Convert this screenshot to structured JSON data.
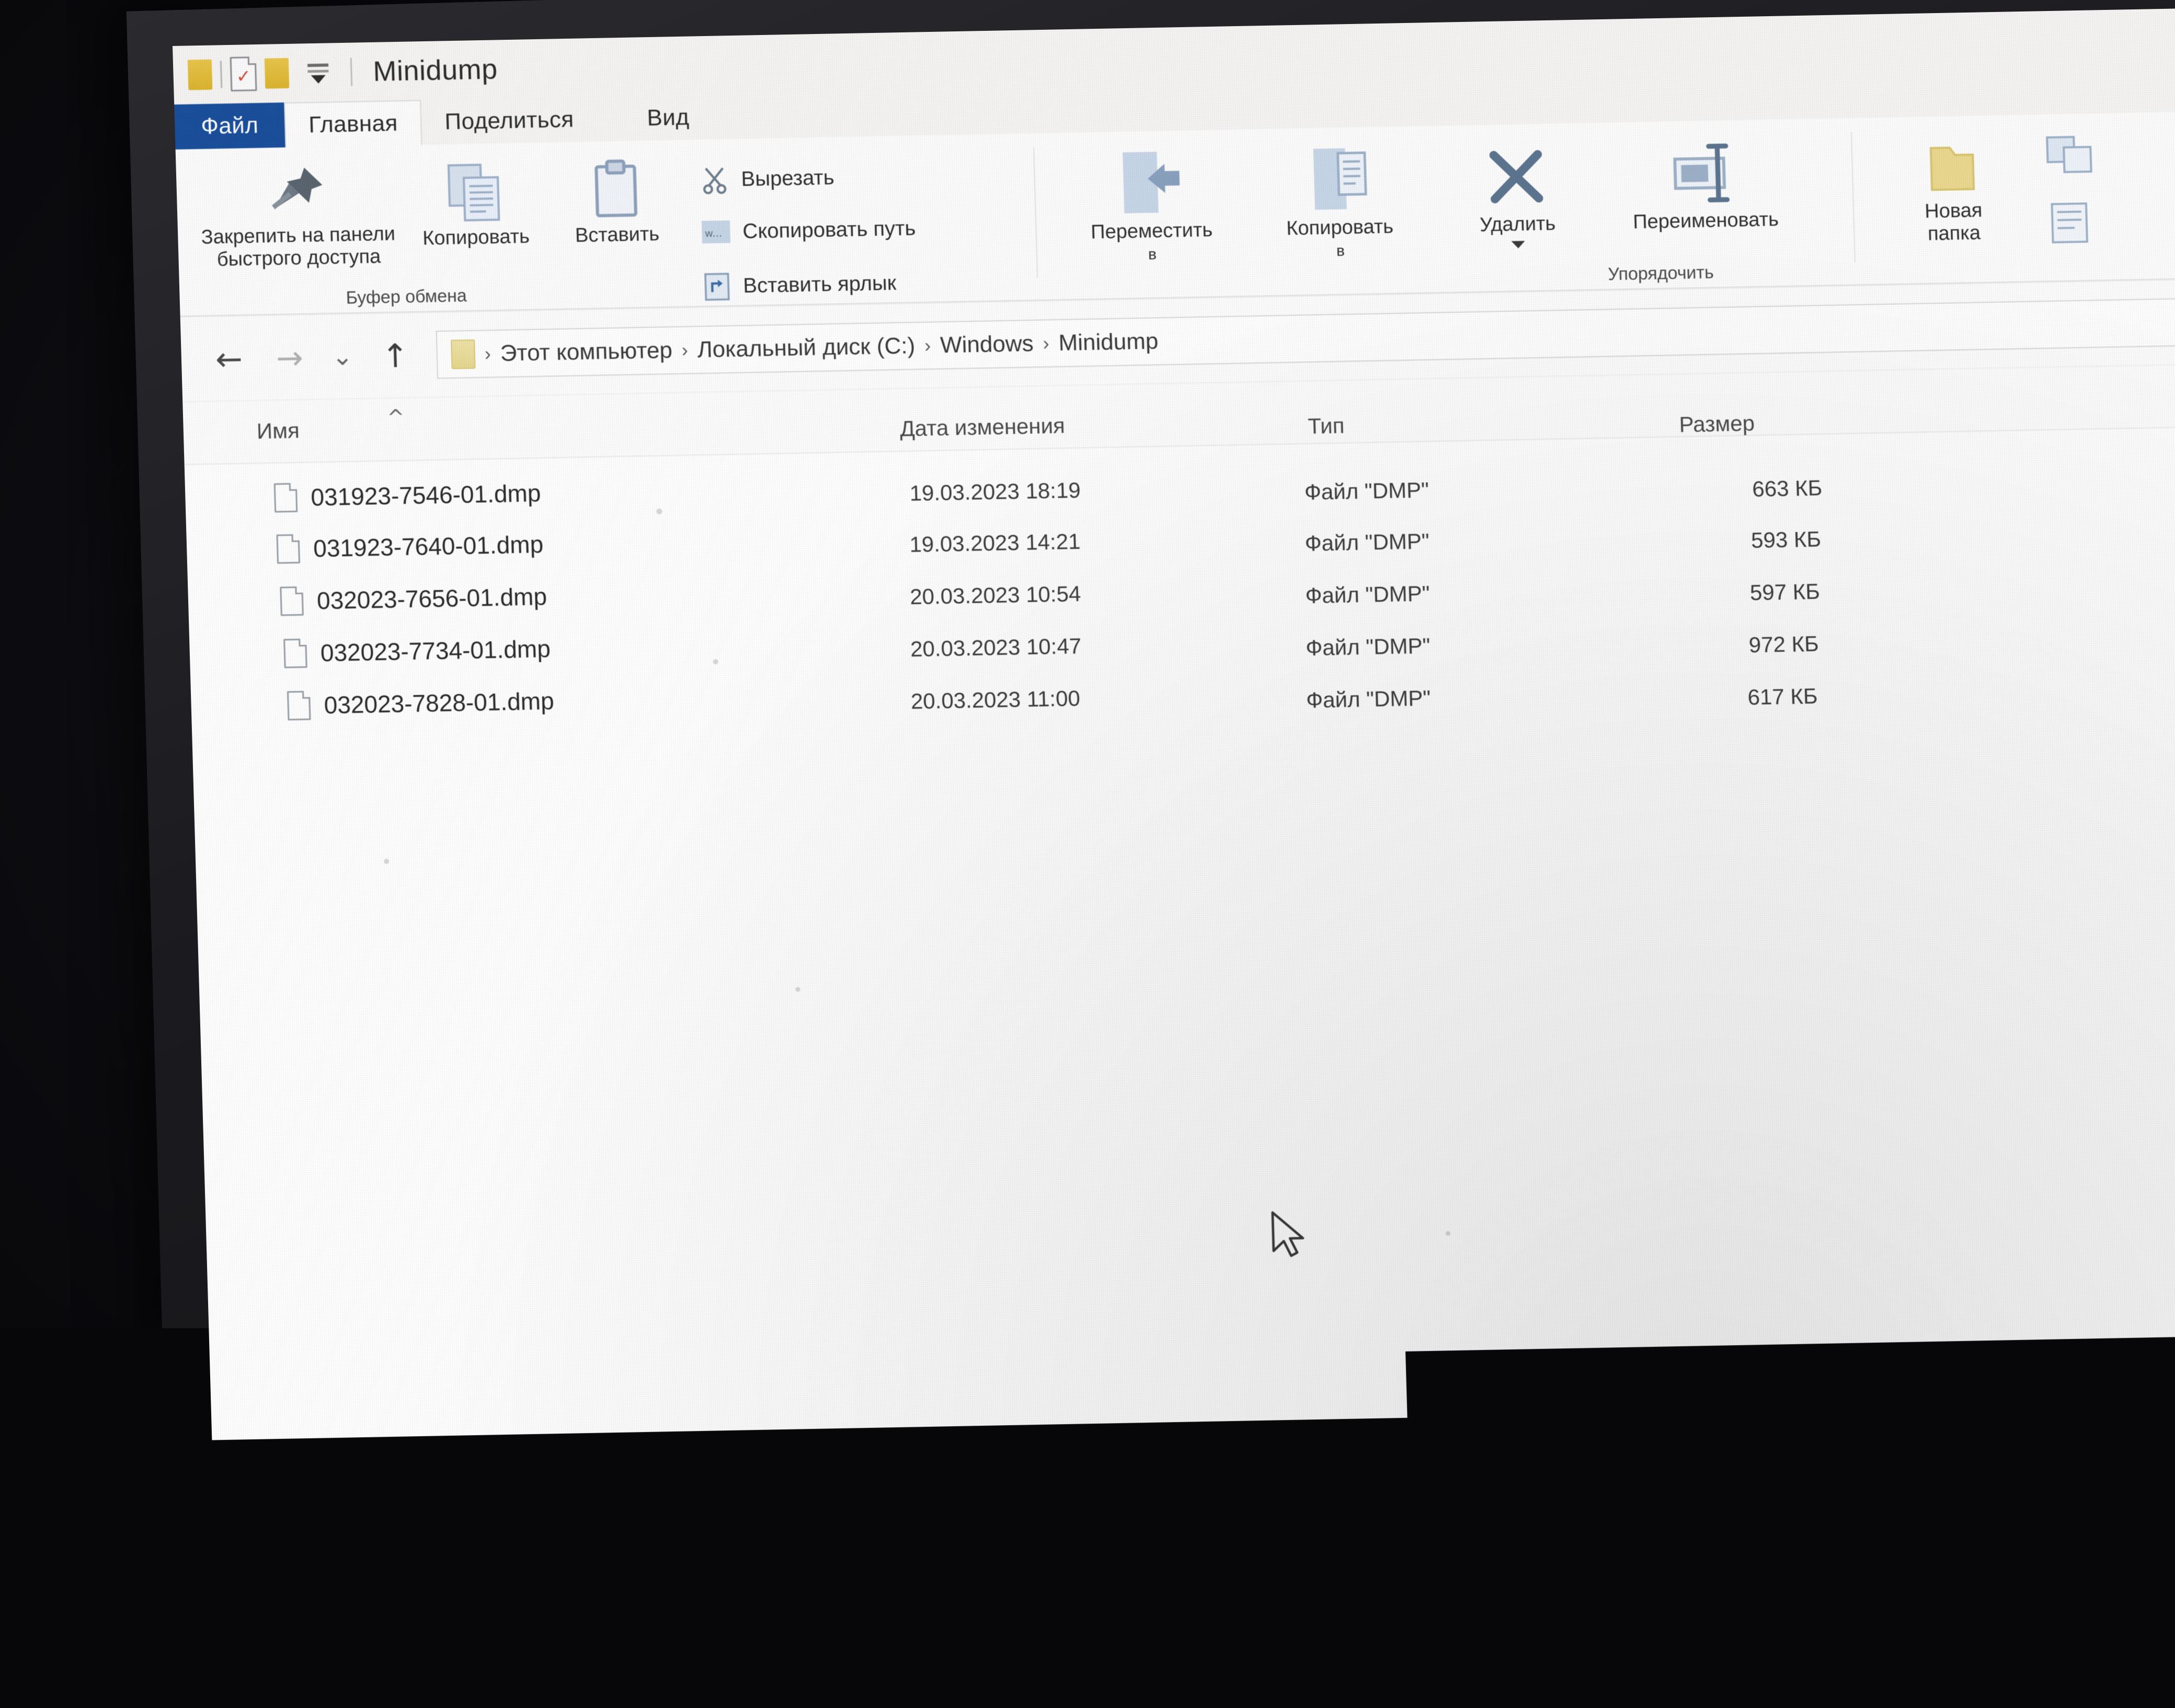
{
  "window": {
    "title": "Minidump",
    "quick_access": [
      "folder-icon",
      "separator",
      "properties-icon",
      "new-folder-icon",
      "customize-caret"
    ]
  },
  "tabs": [
    {
      "id": "file",
      "label": "Файл",
      "active": false,
      "is_file_menu": true
    },
    {
      "id": "home",
      "label": "Главная",
      "active": true,
      "is_file_menu": false
    },
    {
      "id": "share",
      "label": "Поделиться",
      "active": false,
      "is_file_menu": false
    },
    {
      "id": "view",
      "label": "Вид",
      "active": false,
      "is_file_menu": false
    }
  ],
  "ribbon": {
    "groups": [
      {
        "id": "clipboard",
        "label": "Буфер обмена"
      },
      {
        "id": "organize",
        "label": "Упорядочить"
      },
      {
        "id": "new",
        "label": ""
      }
    ],
    "buttons": {
      "pin": {
        "label": "Закрепить на панели\nбыстрого доступа",
        "icon": "pin-icon"
      },
      "copy": {
        "label": "Копировать",
        "icon": "copy-icon"
      },
      "paste": {
        "label": "Вставить",
        "icon": "paste-icon"
      },
      "cut": {
        "label": "Вырезать",
        "icon": "scissors-icon"
      },
      "copy_path": {
        "label": "Скопировать путь",
        "icon": "copy-path-icon"
      },
      "paste_link": {
        "label": "Вставить ярлык",
        "icon": "paste-shortcut-icon"
      },
      "move_to": {
        "label": "Переместить",
        "sublabel": "в",
        "icon": "move-to-icon"
      },
      "copy_to": {
        "label": "Копировать",
        "sublabel": "в",
        "icon": "copy-to-icon"
      },
      "delete": {
        "label": "Удалить",
        "sublabel": "",
        "icon": "delete-x-icon"
      },
      "rename": {
        "label": "Переименовать",
        "icon": "rename-icon"
      },
      "new_folder": {
        "label": "Новая\nпапка",
        "icon": "new-folder-icon"
      }
    }
  },
  "navigation": {
    "back": "←",
    "forward": "→",
    "recent": "⌄",
    "up": "↑",
    "breadcrumb": [
      "Этот компьютер",
      "Локальный диск (C:)",
      "Windows",
      "Minidump"
    ],
    "separator": "›"
  },
  "columns": [
    {
      "id": "name",
      "label": "Имя",
      "sorted": "asc"
    },
    {
      "id": "date",
      "label": "Дата изменения",
      "sorted": ""
    },
    {
      "id": "type",
      "label": "Тип",
      "sorted": ""
    },
    {
      "id": "size",
      "label": "Размер",
      "sorted": ""
    }
  ],
  "files": [
    {
      "name": "031923-7546-01.dmp",
      "date": "19.03.2023 18:19",
      "type": "Файл \"DMP\"",
      "size": "663 КБ"
    },
    {
      "name": "031923-7640-01.dmp",
      "date": "19.03.2023 14:21",
      "type": "Файл \"DMP\"",
      "size": "593 КБ"
    },
    {
      "name": "032023-7656-01.dmp",
      "date": "20.03.2023 10:54",
      "type": "Файл \"DMP\"",
      "size": "597 КБ"
    },
    {
      "name": "032023-7734-01.dmp",
      "date": "20.03.2023 10:47",
      "type": "Файл \"DMP\"",
      "size": "972 КБ"
    },
    {
      "name": "032023-7828-01.dmp",
      "date": "20.03.2023 11:00",
      "type": "Файл \"DMP\"",
      "size": "617 КБ"
    }
  ],
  "colors": {
    "file_tab_blue": "#1a4f9c",
    "folder_yellow": "#e9c64b",
    "icon_blue": "#8fa8c8",
    "window_bg": "#f6f5f4",
    "list_bg": "#ffffff"
  }
}
